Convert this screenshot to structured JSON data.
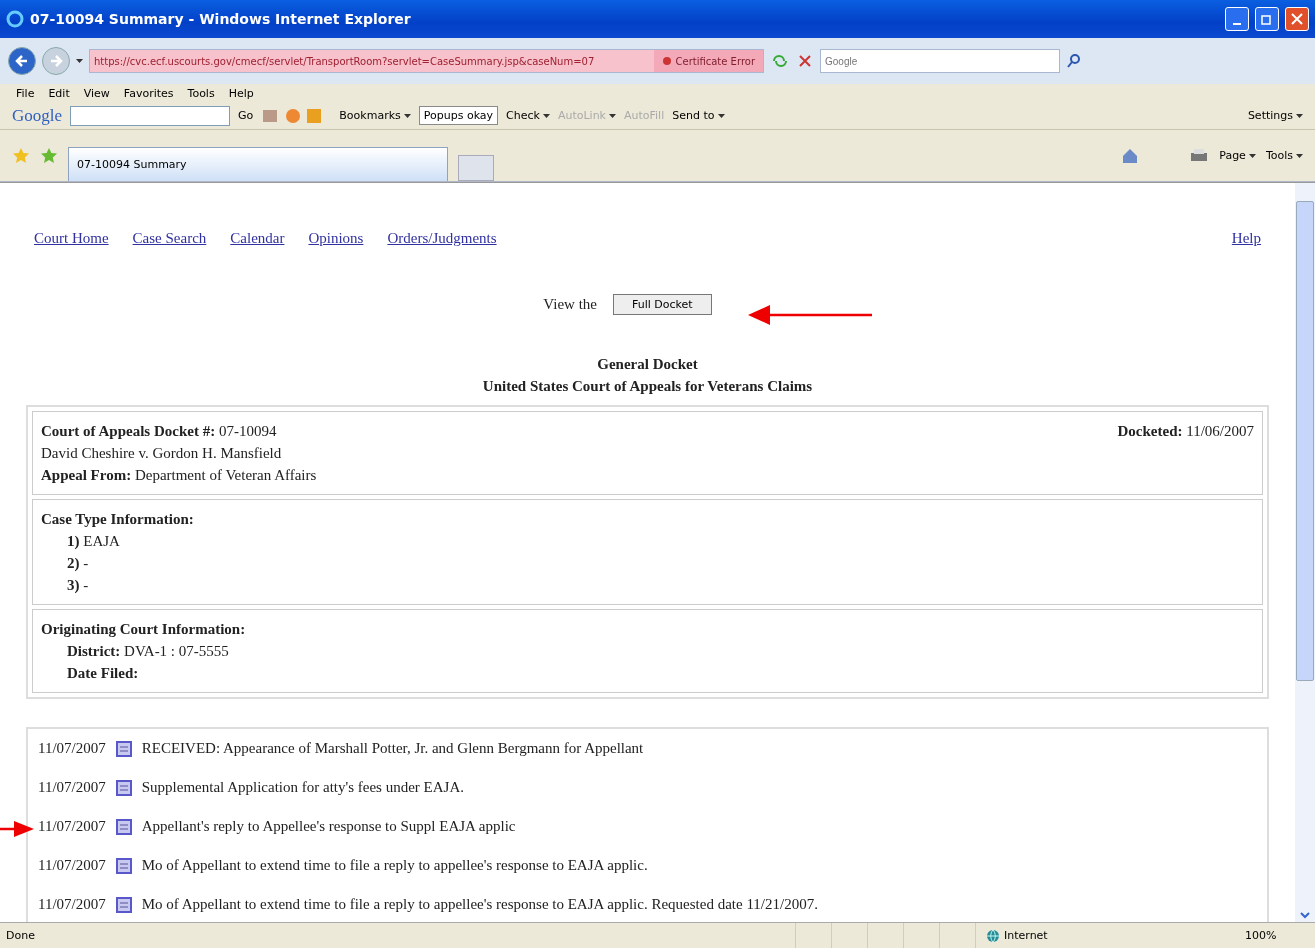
{
  "window": {
    "title": "07-10094 Summary - Windows Internet Explorer"
  },
  "address_bar": {
    "url": "https://cvc.ecf.uscourts.gov/cmecf/servlet/TransportRoom?servlet=CaseSummary.jsp&caseNum=07",
    "certificate": "Certificate Error",
    "search_placeholder": "Google"
  },
  "menu": [
    "File",
    "Edit",
    "View",
    "Favorites",
    "Tools",
    "Help"
  ],
  "google_toolbar": {
    "logo": "Google",
    "go": "Go",
    "items": [
      {
        "label": "Bookmarks",
        "kind": "menu",
        "disabled": false
      },
      {
        "label": "Popups okay",
        "kind": "boxed",
        "disabled": false
      },
      {
        "label": "Check",
        "kind": "menu",
        "disabled": false
      },
      {
        "label": "AutoLink",
        "kind": "menu",
        "disabled": true
      },
      {
        "label": "AutoFill",
        "kind": "plain",
        "disabled": true
      },
      {
        "label": "Send to",
        "kind": "menu",
        "disabled": false
      }
    ],
    "settings": "Settings"
  },
  "tabs": [
    {
      "label": "07-10094 Summary",
      "selected": true
    }
  ],
  "command_bar": [
    "Page",
    "Tools"
  ],
  "page": {
    "nav": [
      "Court Home",
      "Case Search",
      "Calendar",
      "Opinions",
      "Orders/Judgments"
    ],
    "help": "Help",
    "view_the": "View the",
    "full_docket": "Full Docket",
    "heading": [
      "General Docket",
      "United States Court of Appeals for Veterans Claims"
    ],
    "case": {
      "docket_label": "Court of Appeals Docket #:",
      "docket_number": "07-10094",
      "docketed_label": "Docketed:",
      "docketed_date": "11/06/2007",
      "parties": "David Cheshire v. Gordon H. Mansfield",
      "appeal_label": "Appeal From:",
      "appeal_value": "Department of Veteran Affairs"
    },
    "case_type": {
      "title": "Case Type Information:",
      "items": [
        "**1)** EAJA",
        "**2)** -",
        "**3)** -"
      ]
    },
    "originating": {
      "title": "Originating Court Information:",
      "items": [
        {
          "label": "District:",
          "value": "DVA-1 : 07-5555"
        },
        {
          "label": "Date Filed:"
        }
      ]
    },
    "entries": [
      {
        "date": "11/07/2007",
        "text": "RECEIVED: Appearance of Marshall Potter, Jr. and Glenn Bergmann for Appellant"
      },
      {
        "date": "11/07/2007",
        "text": "Supplemental Application for atty's fees under EAJA."
      },
      {
        "date": "11/07/2007",
        "text": "Appellant's reply to Appellee's response to Suppl EAJA applic"
      },
      {
        "date": "11/07/2007",
        "text": "Mo of Appellant to extend time to file a reply to appellee's response to EAJA applic."
      },
      {
        "date": "11/07/2007",
        "text": "Mo of Appellant to extend time to file a reply to appellee's response to EAJA applic. Requested date 11/21/2007."
      }
    ]
  },
  "status_bar": {
    "text": "Done",
    "zone": "Internet",
    "zoom": "100%"
  }
}
